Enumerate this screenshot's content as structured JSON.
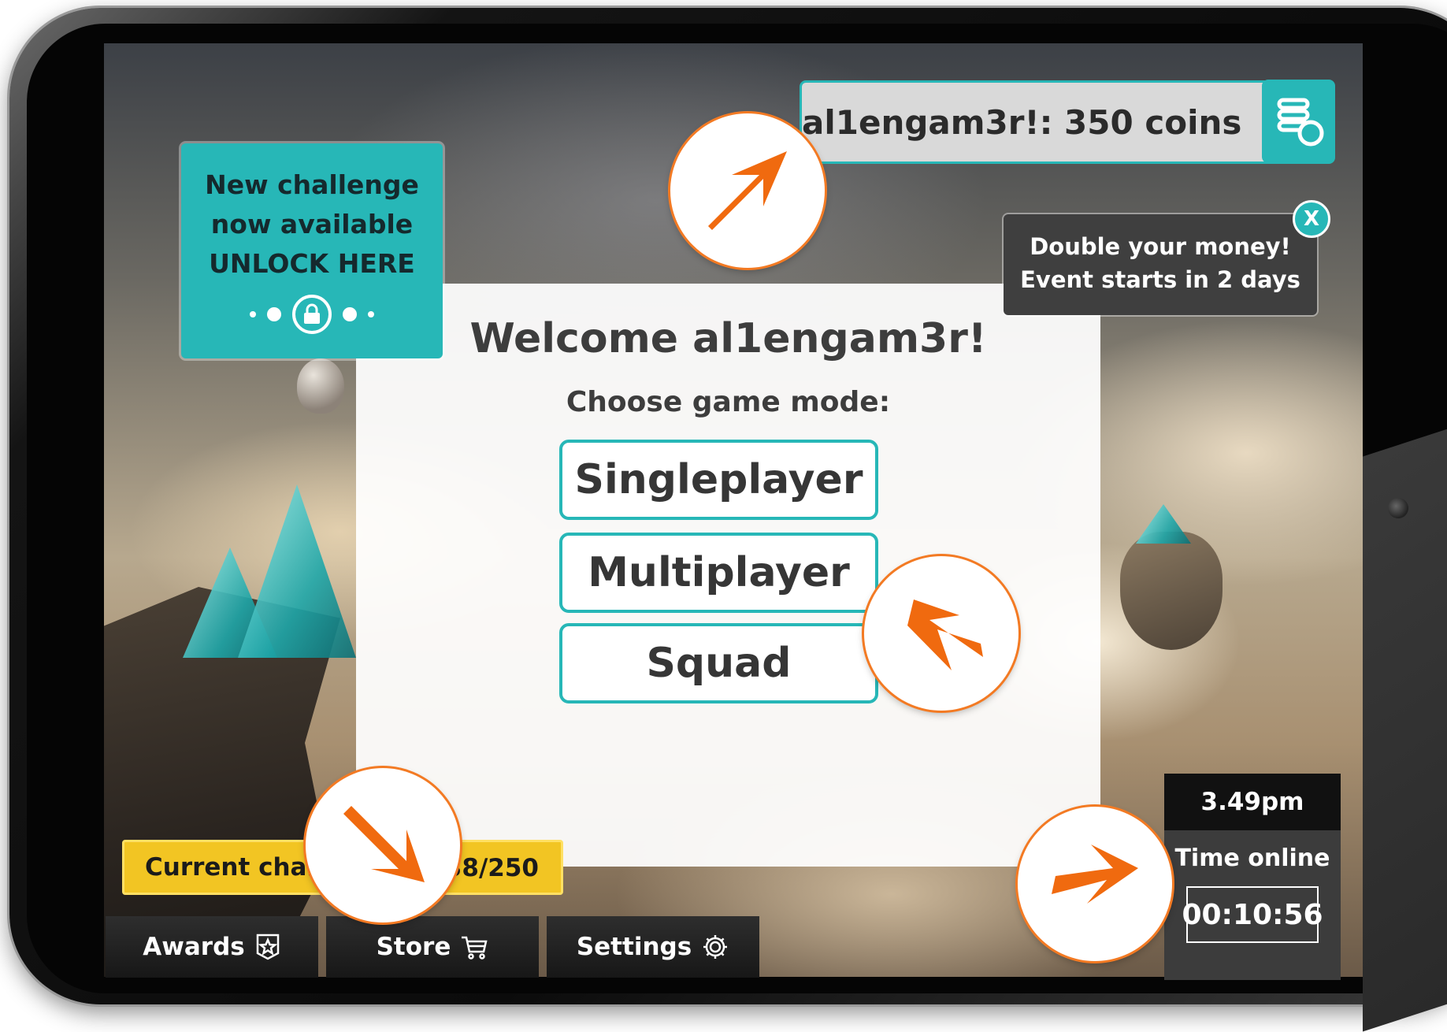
{
  "app": {
    "welcome_title": "Welcome al1engam3r!",
    "choose_label": "Choose game mode:"
  },
  "modes": [
    {
      "label": "Singleplayer"
    },
    {
      "label": "Multiplayer"
    },
    {
      "label": "Squad"
    }
  ],
  "coins": {
    "text": "al1engam3r!:  350 coins",
    "icon": "coins-stack-icon"
  },
  "challenge_card": {
    "line1": "New challenge",
    "line2": "now available",
    "line3": "UNLOCK HERE",
    "icon": "lock-icon"
  },
  "event": {
    "line1": "Double your money!",
    "line2": "Event starts in 2 days",
    "close_label": "X"
  },
  "current_challenge": {
    "label_visible": "Current challe",
    "progress_visible": "38/250"
  },
  "nav": [
    {
      "label": "Awards",
      "icon": "award-star-icon"
    },
    {
      "label": "Store",
      "icon": "shopping-cart-icon"
    },
    {
      "label": "Settings",
      "icon": "gear-icon"
    }
  ],
  "clock": {
    "time": "3.49pm",
    "label": "Time online",
    "elapsed": "00:10:56"
  },
  "colors": {
    "accent": "#27b7b7",
    "highlight": "#f37a23",
    "challenge_bar": "#f2c523",
    "dark_panel": "#3f3f3f"
  }
}
